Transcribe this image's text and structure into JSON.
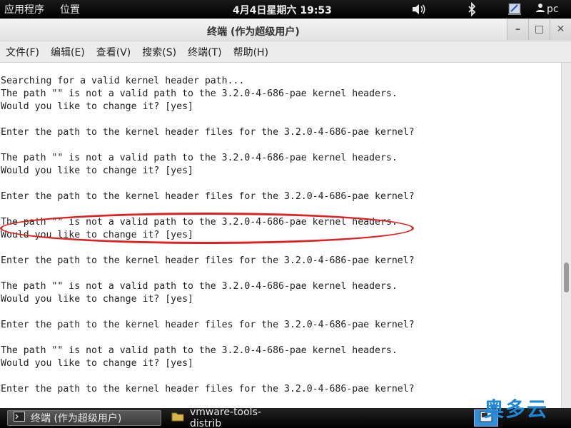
{
  "top_panel": {
    "apps_menu": "应用程序",
    "places_menu": "位置",
    "clock": "4月4日星期六 19:53",
    "user": "pc",
    "icons": [
      "volume-icon",
      "bluetooth-icon",
      "accessibility-icon",
      "user-icon"
    ]
  },
  "window": {
    "title": "终端 (作为超级用户)",
    "controls": {
      "minimize": "–",
      "maximize": "□",
      "close": "✕"
    }
  },
  "menu": {
    "items": [
      "文件(F)",
      "编辑(E)",
      "查看(V)",
      "搜索(S)",
      "终端(T)",
      "帮助(H)"
    ]
  },
  "terminal": {
    "lines": [
      "Searching for a valid kernel header path...",
      "The path \"\" is not a valid path to the 3.2.0-4-686-pae kernel headers.",
      "Would you like to change it? [yes]",
      "",
      "Enter the path to the kernel header files for the 3.2.0-4-686-pae kernel?",
      "",
      "The path \"\" is not a valid path to the 3.2.0-4-686-pae kernel headers.",
      "Would you like to change it? [yes]",
      "",
      "Enter the path to the kernel header files for the 3.2.0-4-686-pae kernel?",
      "",
      "The path \"\" is not a valid path to the 3.2.0-4-686-pae kernel headers.",
      "Would you like to change it? [yes]",
      "",
      "Enter the path to the kernel header files for the 3.2.0-4-686-pae kernel?",
      "",
      "The path \"\" is not a valid path to the 3.2.0-4-686-pae kernel headers.",
      "Would you like to change it? [yes]",
      "",
      "Enter the path to the kernel header files for the 3.2.0-4-686-pae kernel?",
      "",
      "The path \"\" is not a valid path to the 3.2.0-4-686-pae kernel headers.",
      "Would you like to change it? [yes]",
      "",
      "Enter the path to the kernel header files for the 3.2.0-4-686-pae kernel?"
    ]
  },
  "taskbar": {
    "active_task": "终端 (作为超级用户)",
    "other_task": "vmware-tools-distrib"
  },
  "watermark": "奥多云",
  "colors": {
    "highlight": "#dd2222",
    "watermark": "#1e88d8"
  }
}
